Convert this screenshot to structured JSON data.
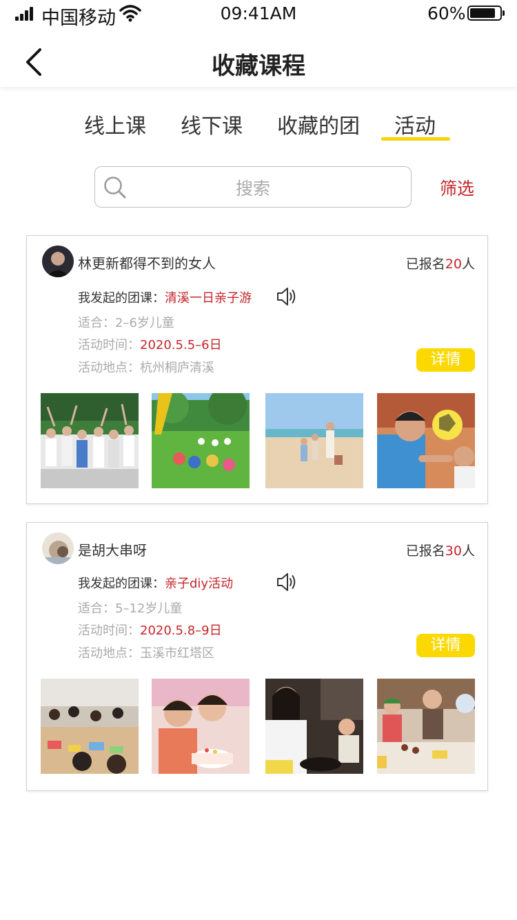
{
  "status": {
    "carrier": "中国移动",
    "time": "09:41AM",
    "battery": "60%"
  },
  "nav": {
    "title": "收藏课程"
  },
  "tabs": [
    {
      "label": "线上课",
      "active": false
    },
    {
      "label": "线下课",
      "active": false
    },
    {
      "label": "收藏的团",
      "active": false
    },
    {
      "label": "活动",
      "active": true
    }
  ],
  "search": {
    "placeholder": "搜索",
    "filter_label": "筛选"
  },
  "colors": {
    "accent_yellow": "#fbd900",
    "accent_red": "#c4252a"
  },
  "cards": [
    {
      "user": "林更新都得不到的女人",
      "enroll_prefix": "已报名",
      "enroll_count": "20",
      "enroll_suffix": "人",
      "group_label": "我发起的团课：",
      "group_name": "清溪一日亲子游",
      "age_label": "适合：",
      "age_value": "2–6岁儿童",
      "time_label": "活动时间：",
      "time_value": "2020.5.5–6日",
      "place_label": "活动地点：",
      "place_value": "杭州桐庐清溪",
      "detail_label": "详情"
    },
    {
      "user": "是胡大串呀",
      "enroll_prefix": "已报名",
      "enroll_count": "30",
      "enroll_suffix": "人",
      "group_label": "我发起的团课：",
      "group_name": "亲子diy活动",
      "age_label": "适合：",
      "age_value": "5–12岁儿童",
      "time_label": "活动时间：",
      "time_value": "2020.5.8–9日",
      "place_label": "活动地点：",
      "place_value": "玉溪市红塔区",
      "detail_label": "详情"
    }
  ]
}
